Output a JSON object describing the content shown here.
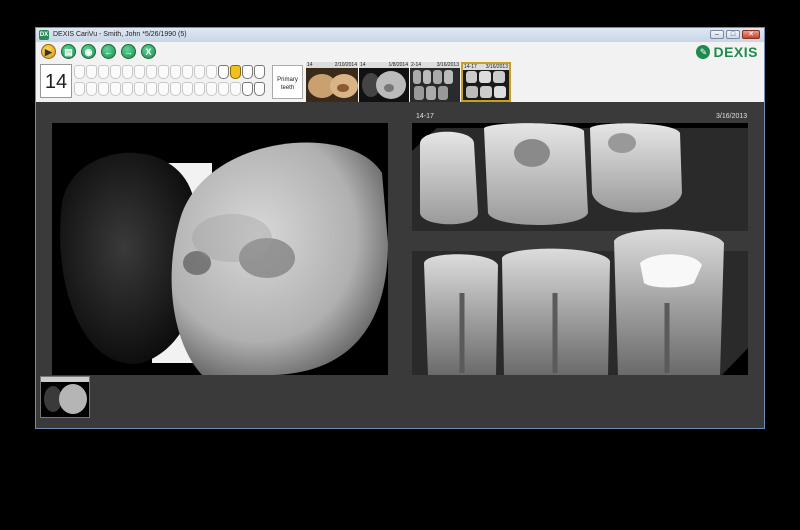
{
  "window": {
    "title": "DEXIS CariVu - Smith, John *5/26/1990 (5)",
    "app_icon_text": "DX",
    "controls": {
      "minimize": "–",
      "maximize": "□",
      "close": "✕"
    }
  },
  "toolbar": {
    "buttons": [
      {
        "name": "play-button",
        "glyph": "▶",
        "color": "yellow"
      },
      {
        "name": "open-folder-button",
        "glyph": "▤",
        "color": "green"
      },
      {
        "name": "view-button",
        "glyph": "◉",
        "color": "green"
      },
      {
        "name": "back-button",
        "glyph": "←",
        "color": "green"
      },
      {
        "name": "forward-button",
        "glyph": "→",
        "color": "green"
      },
      {
        "name": "close-image-button",
        "glyph": "X",
        "color": "green"
      }
    ],
    "logo_text": "DEXIS",
    "logo_icon": "wrench-icon"
  },
  "tooth_chart": {
    "selected_tooth": "14",
    "primary_label_1": "Primary",
    "primary_label_2": "teeth"
  },
  "thumbnails": [
    {
      "tooth": "14",
      "date": "2/10/2014",
      "kind": "photo"
    },
    {
      "tooth": "14",
      "date": "1/8/2014",
      "kind": "transillumination"
    },
    {
      "tooth": "2-14",
      "date": "3/16/2013",
      "kind": "xray"
    },
    {
      "tooth": "14-17",
      "date": "3/16/2013",
      "kind": "xray",
      "selected": true
    }
  ],
  "right_image": {
    "label": "14-17",
    "date": "3/16/2013"
  },
  "colors": {
    "accent_green": "#1e8a4e",
    "selected_gold": "#f0c020",
    "workspace": "#3a3a3a"
  }
}
